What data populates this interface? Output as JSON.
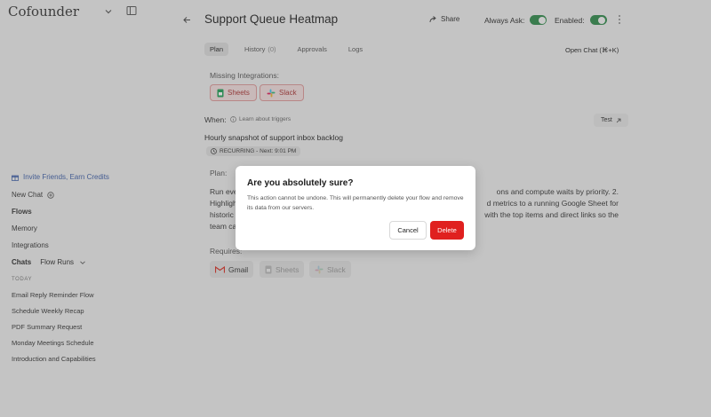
{
  "sidebar": {
    "brand": "Cofounder",
    "invite_label": "Invite Friends, Earn Credits",
    "nav": {
      "new_chat": "New Chat",
      "flows": "Flows",
      "memory": "Memory",
      "integrations": "Integrations"
    },
    "chats_label": "Chats",
    "chats_filter": "Flow Runs",
    "today_label": "TODAY",
    "history": [
      "Email Reply Reminder Flow",
      "Schedule Weekly Recap",
      "PDF Summary Request",
      "Monday Meetings Schedule",
      "Introduction and Capabilities"
    ]
  },
  "header": {
    "title": "Support Queue Heatmap",
    "share_label": "Share",
    "always_ask_label": "Always Ask:",
    "enabled_label": "Enabled:",
    "always_ask_on": true,
    "enabled_on": true
  },
  "tabs": {
    "plan": "Plan",
    "history": "History",
    "history_count": "(0)",
    "approvals": "Approvals",
    "logs": "Logs",
    "open_chat": "Open Chat (⌘+K)"
  },
  "missing": {
    "label": "Missing Integrations:",
    "items": [
      "Sheets",
      "Slack"
    ]
  },
  "trigger": {
    "when_label": "When:",
    "learn_label": "Learn about triggers",
    "test_label": "Test",
    "description": "Hourly snapshot of support inbox backlog",
    "recurring": "RECURRING - Next: 9:01 PM"
  },
  "plan": {
    "label": "Plan:",
    "text_lines": [
      "Run eve",
      "ons and compute waits by priority. 2.",
      "Highligh",
      "d metrics to a running Google Sheet for",
      "historic",
      "with the top items and direct links so the",
      "team ca"
    ]
  },
  "requires": {
    "label": "Requires:",
    "items": [
      "Gmail",
      "Sheets",
      "Slack"
    ]
  },
  "dialog": {
    "title": "Are you absolutely sure?",
    "body": "This action cannot be undone. This will permanently delete your flow and remove its data from our servers.",
    "cancel_label": "Cancel",
    "delete_label": "Delete"
  },
  "colors": {
    "toggle_on": "#2f8a4a",
    "delete_button": "#e0201f",
    "link_blue": "#3d5fa8"
  }
}
